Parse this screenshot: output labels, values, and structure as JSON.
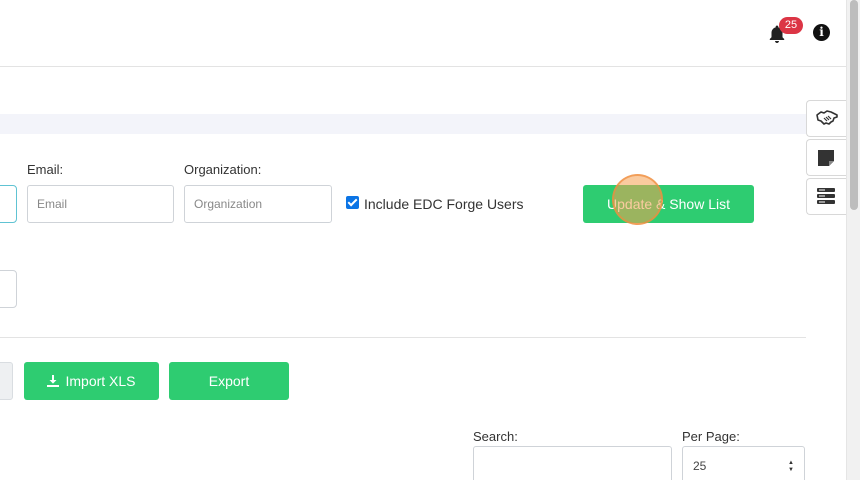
{
  "header": {
    "notifications_count": "25",
    "bell_icon": "bell-icon",
    "info_icon": "info-icon",
    "info_glyph": "i"
  },
  "filters": {
    "email_label": "Email:",
    "email_placeholder": "Email",
    "organization_label": "Organization:",
    "organization_placeholder": "Organization",
    "include_edc_label": "Include EDC Forge Users",
    "include_edc_checked": true,
    "update_button": "Update & Show List"
  },
  "actions": {
    "import_label": "Import XLS",
    "import_icon": "download-icon",
    "export_label": "Export"
  },
  "table_controls": {
    "search_label": "Search:",
    "per_page_label": "Per Page:",
    "per_page_value": "25"
  },
  "side_tools": [
    "handshake-icon",
    "sticky-note-icon",
    "server-icon"
  ],
  "colors": {
    "accent_green": "#2ecc71",
    "badge_red": "#dc3545",
    "checkbox_blue": "#0b74e5"
  }
}
